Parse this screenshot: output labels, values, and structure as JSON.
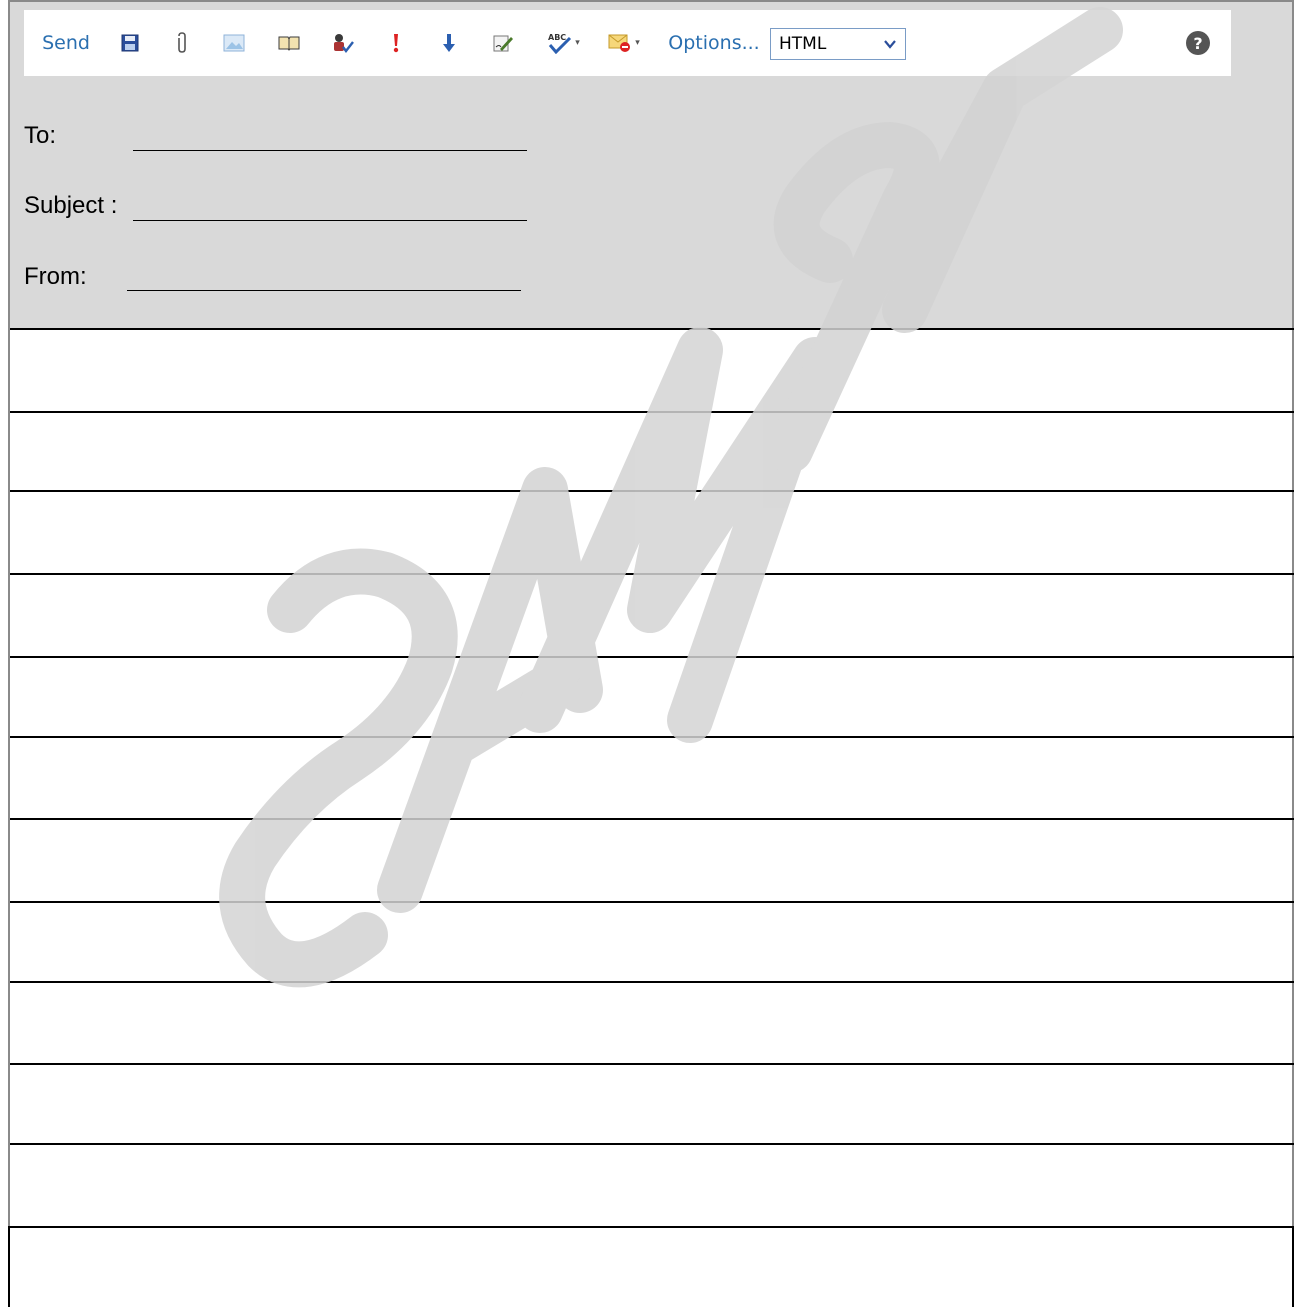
{
  "toolbar": {
    "send_label": "Send",
    "options_label": "Options...",
    "format_select": {
      "selected": "HTML"
    },
    "icons": [
      "save-icon",
      "attach-icon",
      "insert-image-icon",
      "address-book-icon",
      "check-names-icon",
      "high-importance-icon",
      "low-importance-icon",
      "signature-icon",
      "spelling-icon",
      "permission-icon",
      "help-icon"
    ]
  },
  "fields": {
    "to_label": "To:",
    "subject_label": "Subject :",
    "from_label": "From:"
  },
  "watermark": {
    "text": "SAMPLE"
  },
  "colors": {
    "header_bg": "#d9d9d9",
    "link_blue": "#2a6fb0",
    "watermark_gray": "#d3d3d3"
  }
}
